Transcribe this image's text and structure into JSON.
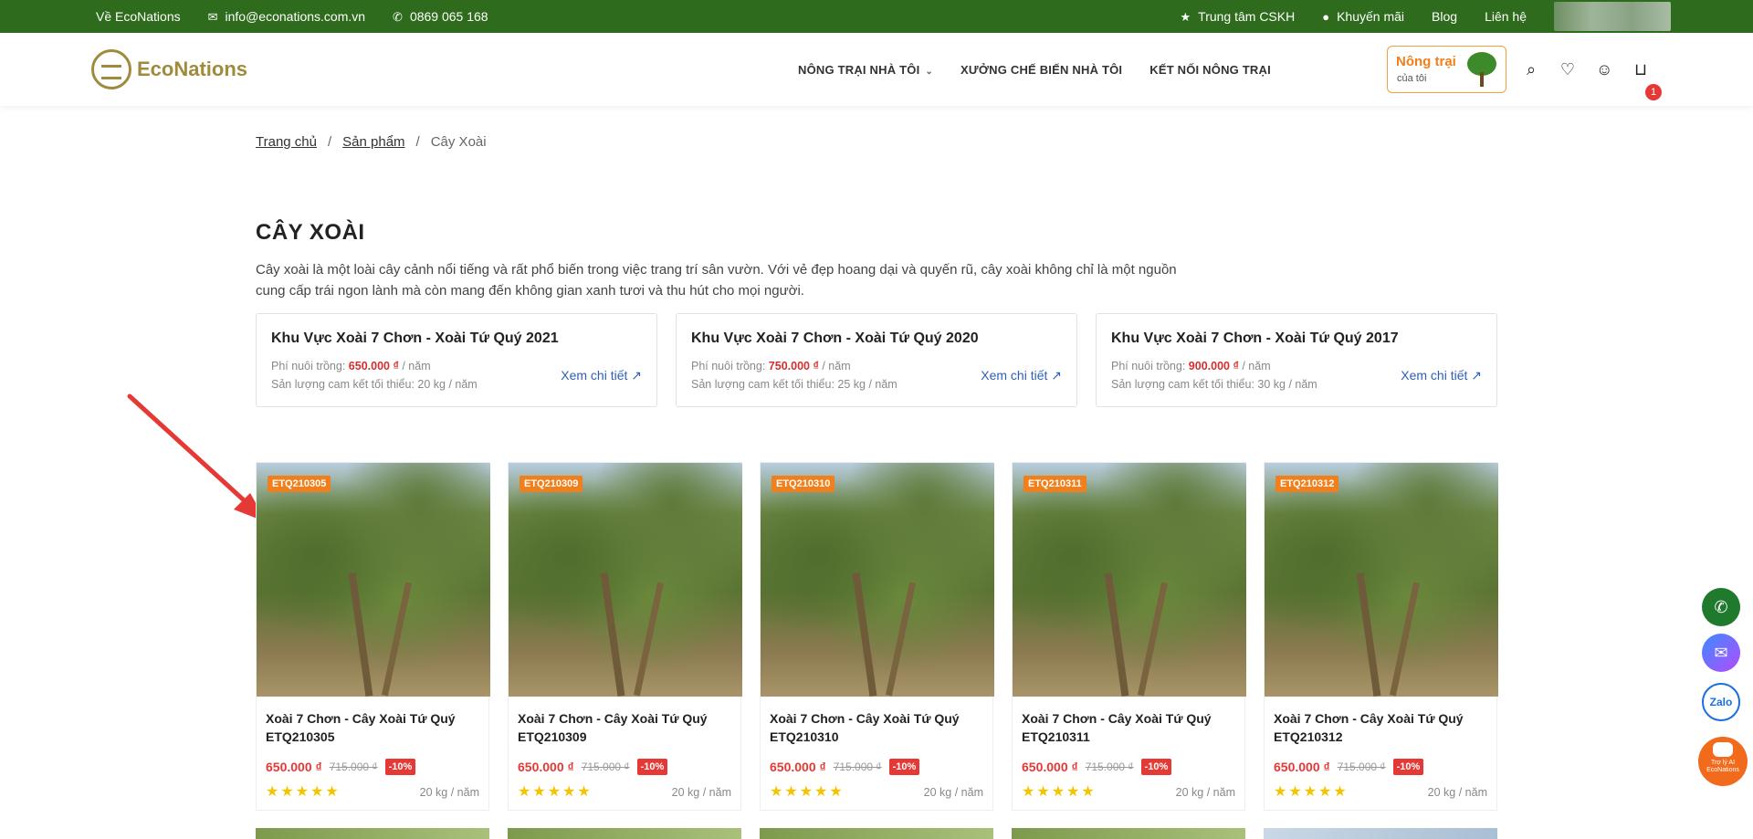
{
  "topbar": {
    "about": "Về EcoNations",
    "email": "info@econations.com.vn",
    "phone": "0869 065 168",
    "support": "Trung tâm CSKH",
    "promo": "Khuyến mãi",
    "blog": "Blog",
    "contact": "Liên hệ"
  },
  "header": {
    "logo_text": "EcoNations",
    "nav": [
      "NÔNG TRẠI NHÀ TÔI",
      "XƯỞNG CHẾ BIẾN NHÀ TÔI",
      "KẾT NỐI NÔNG TRẠI"
    ],
    "farm_button": {
      "line1": "Nông trại",
      "line2": "của tôi"
    },
    "cart_count": "1"
  },
  "breadcrumb": [
    "Trang chủ",
    "Sản phẩm",
    "Cây Xoài"
  ],
  "breadcrumb_sep": "/",
  "page": {
    "title": "CÂY XOÀI",
    "description": "Cây xoài là một loài cây cảnh nổi tiếng và rất phổ biến trong việc trang trí sân vườn. Với vẻ đẹp hoang dại và quyến rũ, cây xoài không chỉ là một nguồn cung cấp trái ngon lành mà còn mang đến không gian xanh tươi và thu hút cho mọi người."
  },
  "zones": [
    {
      "title": "Khu Vực Xoài 7 Chơn - Xoài Tứ Quý 2021",
      "fee_label": "Phí nuôi trồng:",
      "fee": "650.000 ₫",
      "fee_unit": "/ năm",
      "yield": "Sản lượng cam kết tối thiểu: 20 kg / năm",
      "link": "Xem chi tiết"
    },
    {
      "title": "Khu Vực Xoài 7 Chơn - Xoài Tứ Quý 2020",
      "fee_label": "Phí nuôi trồng:",
      "fee": "750.000 ₫",
      "fee_unit": "/ năm",
      "yield": "Sản lượng cam kết tối thiểu: 25 kg / năm",
      "link": "Xem chi tiết"
    },
    {
      "title": "Khu Vực Xoài 7 Chơn - Xoài Tứ Quý 2017",
      "fee_label": "Phí nuôi trồng:",
      "fee": "900.000 ₫",
      "fee_unit": "/ năm",
      "yield": "Sản lượng cam kết tối thiểu: 30 kg / năm",
      "link": "Xem chi tiết"
    }
  ],
  "products": [
    {
      "code": "ETQ210305",
      "name": "Xoài 7 Chơn - Cây Xoài Tứ Quý ETQ210305",
      "price": "650.000 ₫",
      "old_price": "715.000 ₫",
      "discount": "-10%",
      "rating": 5,
      "yield": "20 kg / năm"
    },
    {
      "code": "ETQ210309",
      "name": "Xoài 7 Chơn - Cây Xoài Tứ Quý ETQ210309",
      "price": "650.000 ₫",
      "old_price": "715.000 ₫",
      "discount": "-10%",
      "rating": 5,
      "yield": "20 kg / năm"
    },
    {
      "code": "ETQ210310",
      "name": "Xoài 7 Chơn - Cây Xoài Tứ Quý ETQ210310",
      "price": "650.000 ₫",
      "old_price": "715.000 ₫",
      "discount": "-10%",
      "rating": 5,
      "yield": "20 kg / năm"
    },
    {
      "code": "ETQ210311",
      "name": "Xoài 7 Chơn - Cây Xoài Tứ Quý ETQ210311",
      "price": "650.000 ₫",
      "old_price": "715.000 ₫",
      "discount": "-10%",
      "rating": 5,
      "yield": "20 kg / năm"
    },
    {
      "code": "ETQ210312",
      "name": "Xoài 7 Chơn - Cây Xoài Tứ Quý ETQ210312",
      "price": "650.000 ₫",
      "old_price": "715.000 ₫",
      "discount": "-10%",
      "rating": 5,
      "yield": "20 kg / năm"
    }
  ],
  "floating": {
    "zalo": "Zalo",
    "ai": "Trợ lý AI EcoNations"
  },
  "stars": "★★★★★",
  "icons": {
    "topbar": [
      "email-icon",
      "phone-icon",
      "star-icon",
      "fire-icon"
    ],
    "header": [
      "search-icon",
      "heart-icon",
      "user-icon",
      "cart-icon"
    ],
    "floating": [
      "phone-icon",
      "messenger-icon",
      "zalo-icon",
      "robot-icon"
    ],
    "link": "external-link-icon",
    "nav": "chevron-down-icon"
  },
  "colors": {
    "topbar": "#2e6b1c",
    "accent_orange": "#f07f1c",
    "price_red": "#e53935",
    "link_blue": "#2e5fb8",
    "brand_gold": "#a08a3c",
    "annotation_arrow": "#e53935"
  }
}
